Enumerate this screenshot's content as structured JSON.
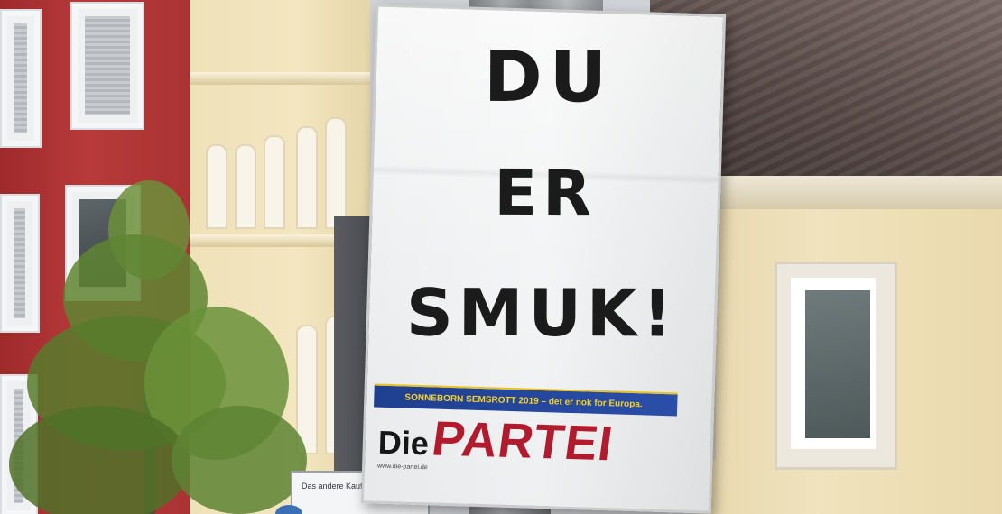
{
  "poster": {
    "slogan": [
      "DU",
      "ER",
      "SMUK!"
    ],
    "tagline": "SONNEBORN SEMSROTT 2019 – det er nok for Europa.",
    "logo": {
      "die": "Die",
      "partei": "PARTEI"
    },
    "url": "www.die-partei.de",
    "colors": {
      "accent_red": "#b21b2d",
      "bar_blue": "#2a4fa8",
      "bar_text": "#f5d22c"
    }
  },
  "background_sign": {
    "text": "Das andere Kaufhaus"
  }
}
